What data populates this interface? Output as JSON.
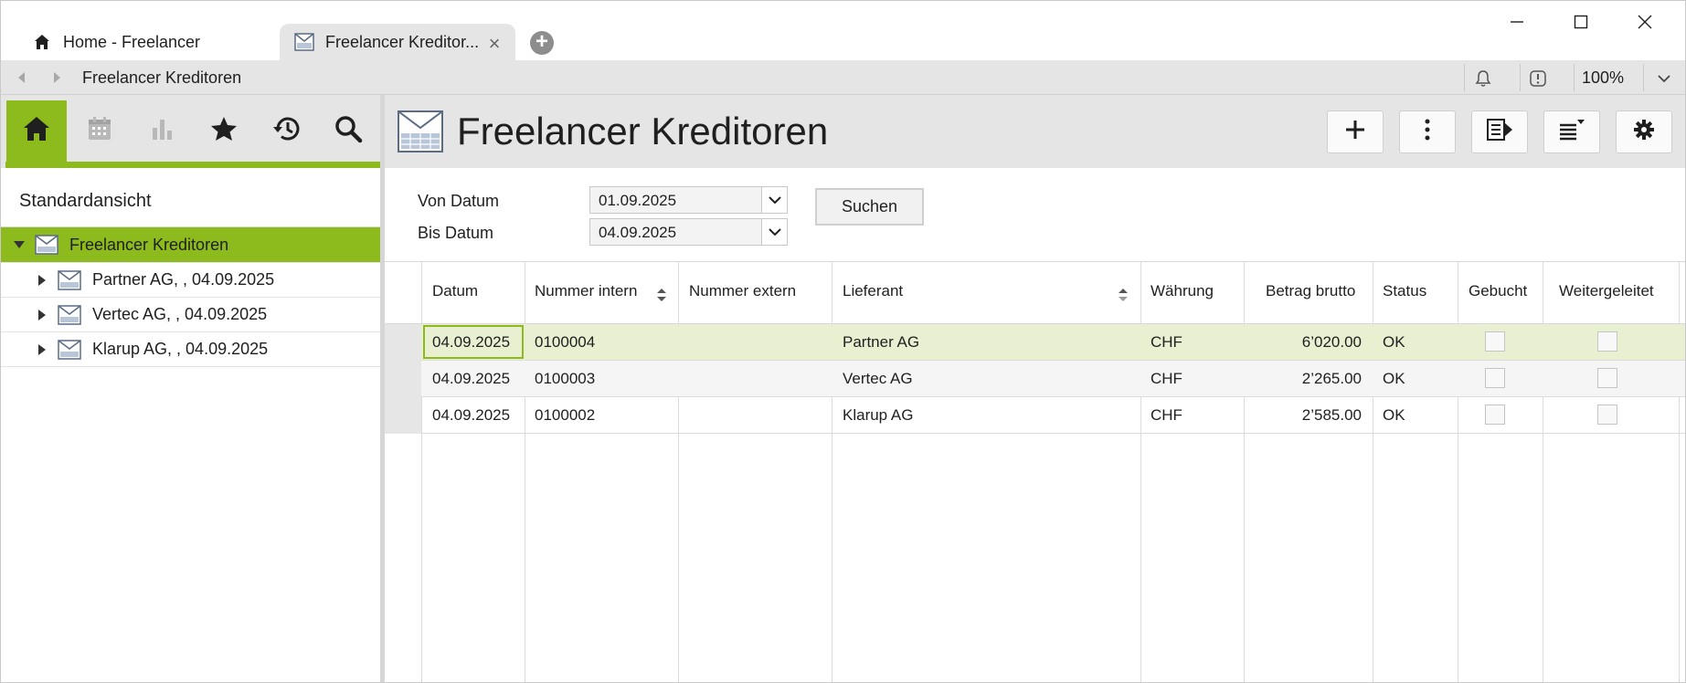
{
  "tabs": [
    {
      "label": "Home - Freelancer",
      "icon": "home-icon"
    },
    {
      "label": "Freelancer Kreditor...",
      "icon": "ledger-icon",
      "active": true
    }
  ],
  "addressbar": {
    "title": "Freelancer Kreditoren",
    "zoom": "100%"
  },
  "sidebar": {
    "toolbar": [
      "home-icon",
      "calendar-icon",
      "bar-chart-icon",
      "star-icon",
      "history-icon",
      "search-icon"
    ],
    "view_label": "Standardansicht",
    "tree": {
      "root": "Freelancer Kreditoren",
      "children": [
        "Partner AG, , 04.09.2025",
        "Vertec AG, , 04.09.2025",
        "Klarup AG, , 04.09.2025"
      ]
    }
  },
  "main": {
    "title": "Freelancer Kreditoren",
    "header_buttons": [
      "plus-icon",
      "more-vertical-icon",
      "report-icon",
      "list-sort-icon",
      "gear-icon"
    ],
    "filter": {
      "from_label": "Von Datum",
      "from_value": "01.09.2025",
      "to_label": "Bis Datum",
      "to_value": "04.09.2025",
      "search_label": "Suchen"
    },
    "grid": {
      "columns": [
        "Datum",
        "Nummer intern",
        "Nummer extern",
        "Lieferant",
        "Währung",
        "Betrag brutto",
        "Status",
        "Gebucht",
        "Weitergeleitet"
      ],
      "rows": [
        {
          "datum": "04.09.2025",
          "nr_intern": "0100004",
          "nr_extern": "",
          "lieferant": "Partner AG",
          "waehrung": "CHF",
          "betrag": "6’020.00",
          "status": "OK",
          "gebucht": false,
          "weitergeleitet": false
        },
        {
          "datum": "04.09.2025",
          "nr_intern": "0100003",
          "nr_extern": "",
          "lieferant": "Vertec AG",
          "waehrung": "CHF",
          "betrag": "2’265.00",
          "status": "OK",
          "gebucht": false,
          "weitergeleitet": false
        },
        {
          "datum": "04.09.2025",
          "nr_intern": "0100002",
          "nr_extern": "",
          "lieferant": "Klarup AG",
          "waehrung": "CHF",
          "betrag": "2’585.00",
          "status": "OK",
          "gebucht": false,
          "weitergeleitet": false
        }
      ]
    }
  },
  "colors": {
    "accent": "#8dbb1e",
    "selected_row": "#e8f0d1",
    "chrome": "#e5e5e5"
  }
}
